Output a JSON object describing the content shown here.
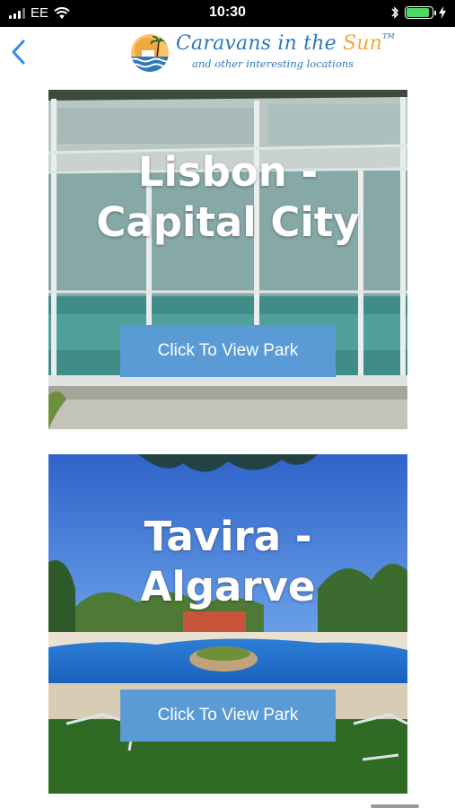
{
  "status_bar": {
    "carrier": "EE",
    "time": "10:30",
    "battery_level": 0.9
  },
  "header": {
    "logo_name_main": "Caravans in the ",
    "logo_name_accent": "Sun",
    "logo_trademark": "TM",
    "logo_tagline": "and other interesting locations"
  },
  "parks": [
    {
      "title_line1": "Lisbon -",
      "title_line2": "Capital City",
      "button_label": "Click To View Park"
    },
    {
      "title_line1": "Tavira -",
      "title_line2": "Algarve",
      "button_label": "Click To View Park"
    }
  ],
  "colors": {
    "accent": "#2f78b9",
    "button": "#5b9bd5",
    "sun": "#f2a83a",
    "battery": "#4cd964"
  }
}
